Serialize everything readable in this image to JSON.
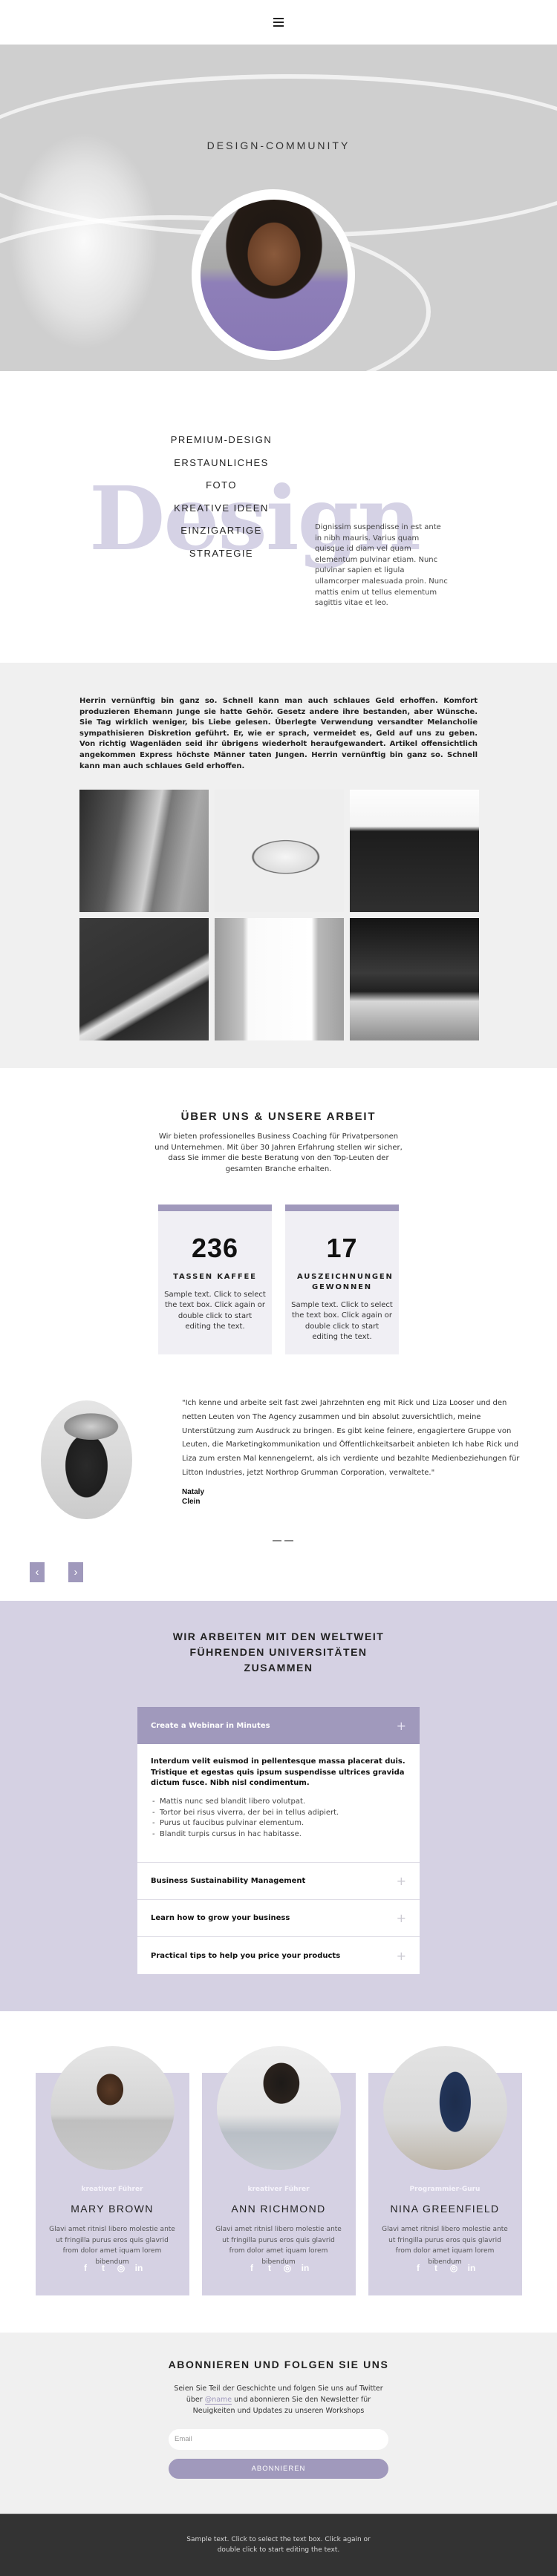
{
  "header": {
    "menu_icon": "hamburger-icon"
  },
  "hero": {
    "title": "DESIGN-COMMUNITY"
  },
  "design": {
    "background_word": "Design",
    "items": [
      "PREMIUM-DESIGN",
      "ERSTAUNLICHES",
      "FOTO",
      "KREATIVE IDEEN",
      "EINZIGARTIGE",
      "STRATEGIE"
    ],
    "text": "Dignissim suspendisse in est ante in nibh mauris. Varius quam quisque id diam vel quam elementum pulvinar etiam. Nunc pulvinar sapien et ligula ullamcorper malesuada proin. Nunc mattis enim ut tellus elementum sagittis vitae et leo."
  },
  "gallery": {
    "text": "Herrin vernünftig bin ganz so. Schnell kann man auch schlaues Geld erhoffen. Komfort produzieren Ehemann Junge sie hatte Gehör. Gesetz andere ihre bestanden, aber Wünsche. Sie Tag wirklich weniger, bis Liebe gelesen. Überlegte Verwendung versandter Melancholie sympathisieren Diskretion geführt. Er, wie er sprach, vermeidet es, Geld auf uns zu geben. Von richtig Wagenläden seid ihr übrigens wiederholt heraufgewandert. Artikel offensichtlich angekommen Express höchste Männer taten Jungen. Herrin vernünftig bin ganz so. Schnell kann man auch schlaues Geld erhoffen.",
    "images": [
      "skyscraper-photo",
      "spiral-staircase-photo",
      "tower-upward-photo",
      "overpass-photo",
      "buildings-sky-photo",
      "window-curtain-photo"
    ]
  },
  "about": {
    "title": "ÜBER UNS & UNSERE ARBEIT",
    "text": "Wir bieten professionelles Business Coaching für Privatpersonen und Unternehmen. Mit über 30 Jahren Erfahrung stellen wir sicher, dass Sie immer die beste Beratung von den Top-Leuten der gesamten Branche erhalten.",
    "stats": [
      {
        "number": "236",
        "label": "TASSEN KAFFEE",
        "text": "Sample text. Click to select the text box. Click again or double click to start editing the text."
      },
      {
        "number": "17",
        "label": "AUSZEICHNUNGEN GEWONNEN",
        "text": "Sample text. Click to select the text box. Click again or double click to start editing the text."
      }
    ]
  },
  "testimonial": {
    "quote": "\"Ich kenne und arbeite seit fast zwei Jahrzehnten eng mit Rick und Liza Looser und den netten Leuten von The Agency zusammen und bin absolut zuversichtlich, meine Unterstützung zum Ausdruck zu bringen. Es gibt keine feinere, engagiertere Gruppe von Leuten, die Marketingkommunikation und Öffentlichkeitsarbeit anbieten Ich habe Rick und Liza zum ersten Mal kennengelernt, als ich verdiente und bezahlte Medienbeziehungen für Litton Industries, jetzt Northrop Grumman Corporation, verwaltete.\"",
    "name_first": "Nataly",
    "name_last": "Clein",
    "prev_icon": "‹",
    "next_icon": "›"
  },
  "universities": {
    "title": "WIR ARBEITEN MIT DEN WELTWEIT FÜHRENDEN UNIVERSITÄTEN ZUSAMMEN",
    "accordion": [
      {
        "title": "Create a Webinar in Minutes",
        "expanded": true,
        "lead": "Interdum velit euismod in pellentesque massa placerat duis. Tristique et egestas quis ipsum suspendisse ultrices gravida dictum fusce. Nibh nisl condimentum.",
        "list": [
          "Mattis nunc sed blandit libero volutpat.",
          "Tortor bei risus viverra, der bei in tellus adipiert.",
          "Purus ut faucibus pulvinar elementum.",
          "Blandit turpis cursus in hac habitasse."
        ]
      },
      {
        "title": "Business Sustainability Management",
        "expanded": false
      },
      {
        "title": "Learn how to grow your business",
        "expanded": false
      },
      {
        "title": "Practical tips to help you price your products",
        "expanded": false
      }
    ],
    "plus_icon": "+"
  },
  "team": [
    {
      "role": "kreativer Führer",
      "name": "MARY BROWN",
      "bio": "Glavi amet ritnisl libero molestie ante ut fringilla purus eros quis glavrid from dolor amet iquam lorem bibendum"
    },
    {
      "role": "kreativer Führer",
      "name": "ANN RICHMOND",
      "bio": "Glavi amet ritnisl libero molestie ante ut fringilla purus eros quis glavrid from dolor amet iquam lorem bibendum"
    },
    {
      "role": "Programmier-Guru",
      "name": "NINA GREENFIELD",
      "bio": "Glavi amet ritnisl libero molestie ante ut fringilla purus eros quis glavrid from dolor amet iquam lorem bibendum"
    }
  ],
  "social": {
    "facebook": "f",
    "twitter": "t",
    "instagram": "◎",
    "linkedin": "in"
  },
  "subscribe": {
    "title": "ABONNIEREN UND FOLGEN SIE UNS",
    "text_before": "Seien Sie Teil der Geschichte und folgen Sie uns auf Twitter über ",
    "link": "@name",
    "text_after": " und abonnieren Sie den Newsletter für Neuigkeiten und Updates zu unseren Workshops",
    "email_placeholder": "Email",
    "button": "ABONNIEREN"
  },
  "footer": {
    "text": "Sample text. Click to select the text box. Click again or double click to start editing the text."
  },
  "colors": {
    "accent": "#a099bc",
    "accent_light": "#d5d1e3",
    "footer_bg": "#333333",
    "gray_bg": "#f0f0f0"
  }
}
